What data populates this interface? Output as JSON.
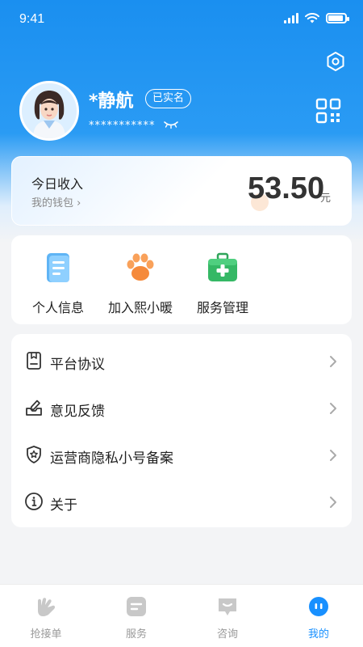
{
  "status_bar": {
    "time": "9:41"
  },
  "profile": {
    "name": "*静航",
    "verified_badge": "已实名",
    "phone_masked": "***********"
  },
  "income": {
    "label": "今日收入",
    "wallet_link": "我的钱包",
    "amount": "53.50",
    "unit": "元"
  },
  "quick_actions": [
    {
      "label": "个人信息",
      "icon": "document-icon"
    },
    {
      "label": "加入熙小暖",
      "icon": "paw-icon"
    },
    {
      "label": "服务管理",
      "icon": "medical-kit-icon"
    }
  ],
  "menu": [
    {
      "label": "平台协议",
      "icon": "agreement-icon"
    },
    {
      "label": "意见反馈",
      "icon": "feedback-icon"
    },
    {
      "label": "运营商隐私小号备案",
      "icon": "shield-star-icon"
    },
    {
      "label": "关于",
      "icon": "info-icon"
    }
  ],
  "tabbar": [
    {
      "label": "抢接单",
      "icon": "grab-order-icon",
      "active": false
    },
    {
      "label": "服务",
      "icon": "service-icon",
      "active": false
    },
    {
      "label": "咨询",
      "icon": "chat-icon",
      "active": false
    },
    {
      "label": "我的",
      "icon": "profile-icon",
      "active": true
    }
  ],
  "colors": {
    "primary": "#1890ff",
    "header_blue": "#1a8ff0",
    "background": "#f3f4f6",
    "tab_inactive": "#999999"
  }
}
